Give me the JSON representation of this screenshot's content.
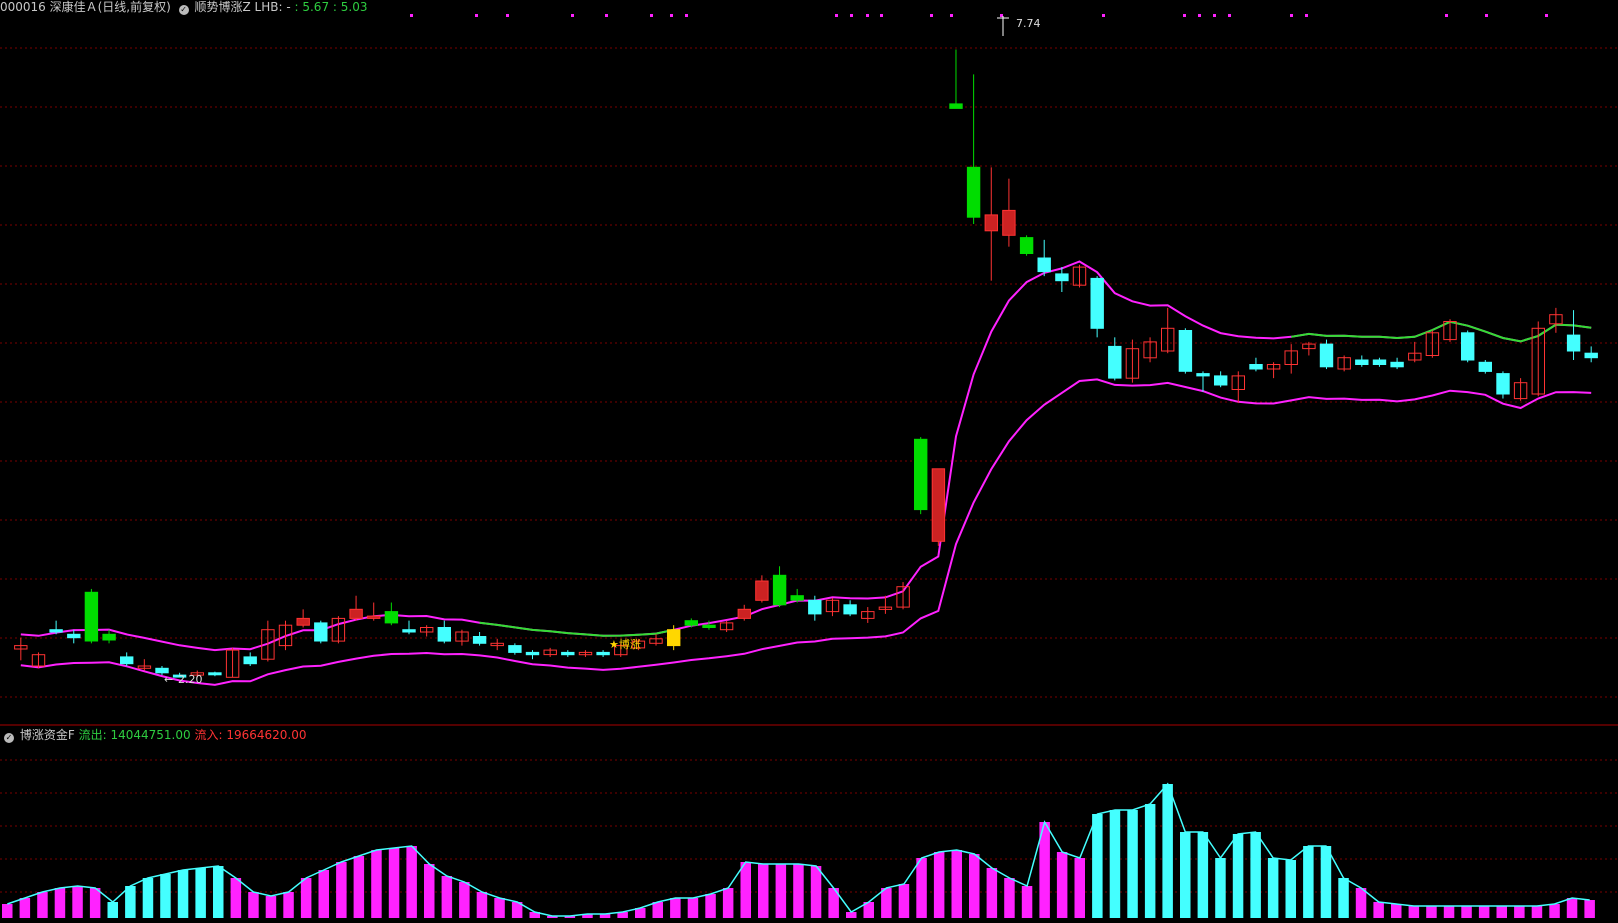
{
  "header": {
    "symbol_title": "000016 深康佳Ａ(日线,前复权)",
    "indicator_name": "顺势博涨Z",
    "lhb_label": "LHB: -",
    "value1": ": 5.67",
    "value2": ": 5.03"
  },
  "sub_panel": {
    "indicator_name": "博涨资金F",
    "outflow_label": "流出:",
    "outflow_value": "14044751.00",
    "inflow_label": "流入:",
    "inflow_value": "19664620.00"
  },
  "annotations": {
    "high_label": "7.74",
    "low_label": "2.20",
    "signal_label": "★博涨"
  },
  "colors": {
    "background": "#000000",
    "grid": "#7a0000",
    "up": "#ff3333",
    "down_solid": "#00dd00",
    "cyan": "#44ffff",
    "magenta": "#ff22ff",
    "green_line": "#33dd33",
    "yellow": "#ffd700"
  },
  "chart_data": {
    "type": "candlestick",
    "y_range": [
      2.0,
      8.0
    ],
    "candles": [
      {
        "o": 2.45,
        "h": 2.55,
        "l": 2.35,
        "c": 2.48,
        "t": "up"
      },
      {
        "o": 2.3,
        "h": 2.42,
        "l": 2.28,
        "c": 2.4,
        "t": "up"
      },
      {
        "o": 2.62,
        "h": 2.7,
        "l": 2.58,
        "c": 2.6,
        "t": "flat"
      },
      {
        "o": 2.55,
        "h": 2.62,
        "l": 2.5,
        "c": 2.58,
        "t": "flat"
      },
      {
        "o": 2.95,
        "h": 2.98,
        "l": 2.5,
        "c": 2.52,
        "t": "down"
      },
      {
        "o": 2.58,
        "h": 2.62,
        "l": 2.5,
        "c": 2.53,
        "t": "down"
      },
      {
        "o": 2.38,
        "h": 2.42,
        "l": 2.3,
        "c": 2.32,
        "t": "cyan"
      },
      {
        "o": 2.3,
        "h": 2.36,
        "l": 2.26,
        "c": 2.28,
        "t": "up"
      },
      {
        "o": 2.28,
        "h": 2.3,
        "l": 2.22,
        "c": 2.24,
        "t": "cyan"
      },
      {
        "o": 2.22,
        "h": 2.24,
        "l": 2.2,
        "c": 2.21,
        "t": "cyan"
      },
      {
        "o": 2.22,
        "h": 2.26,
        "l": 2.2,
        "c": 2.24,
        "t": "up"
      },
      {
        "o": 2.23,
        "h": 2.25,
        "l": 2.21,
        "c": 2.24,
        "t": "flat"
      },
      {
        "o": 2.2,
        "h": 2.46,
        "l": 2.2,
        "c": 2.44,
        "t": "up"
      },
      {
        "o": 2.38,
        "h": 2.42,
        "l": 2.3,
        "c": 2.32,
        "t": "cyan"
      },
      {
        "o": 2.36,
        "h": 2.7,
        "l": 2.34,
        "c": 2.62,
        "t": "up"
      },
      {
        "o": 2.48,
        "h": 2.7,
        "l": 2.44,
        "c": 2.66,
        "t": "up"
      },
      {
        "o": 2.72,
        "h": 2.8,
        "l": 2.64,
        "c": 2.66,
        "t": "upfill"
      },
      {
        "o": 2.68,
        "h": 2.7,
        "l": 2.5,
        "c": 2.52,
        "t": "cyan"
      },
      {
        "o": 2.52,
        "h": 2.74,
        "l": 2.5,
        "c": 2.72,
        "t": "up"
      },
      {
        "o": 2.8,
        "h": 2.92,
        "l": 2.7,
        "c": 2.72,
        "t": "upfill"
      },
      {
        "o": 2.74,
        "h": 2.86,
        "l": 2.7,
        "c": 2.72,
        "t": "upfill"
      },
      {
        "o": 2.78,
        "h": 2.86,
        "l": 2.66,
        "c": 2.68,
        "t": "down"
      },
      {
        "o": 2.62,
        "h": 2.7,
        "l": 2.58,
        "c": 2.6,
        "t": "cyan"
      },
      {
        "o": 2.6,
        "h": 2.66,
        "l": 2.56,
        "c": 2.64,
        "t": "up"
      },
      {
        "o": 2.64,
        "h": 2.7,
        "l": 2.5,
        "c": 2.52,
        "t": "cyan"
      },
      {
        "o": 2.52,
        "h": 2.62,
        "l": 2.48,
        "c": 2.6,
        "t": "up"
      },
      {
        "o": 2.56,
        "h": 2.6,
        "l": 2.48,
        "c": 2.5,
        "t": "cyan"
      },
      {
        "o": 2.5,
        "h": 2.54,
        "l": 2.44,
        "c": 2.48,
        "t": "up"
      },
      {
        "o": 2.48,
        "h": 2.5,
        "l": 2.4,
        "c": 2.42,
        "t": "cyan"
      },
      {
        "o": 2.42,
        "h": 2.44,
        "l": 2.36,
        "c": 2.4,
        "t": "flat"
      },
      {
        "o": 2.4,
        "h": 2.46,
        "l": 2.38,
        "c": 2.44,
        "t": "up"
      },
      {
        "o": 2.42,
        "h": 2.44,
        "l": 2.38,
        "c": 2.4,
        "t": "cyan"
      },
      {
        "o": 2.4,
        "h": 2.44,
        "l": 2.38,
        "c": 2.42,
        "t": "up"
      },
      {
        "o": 2.42,
        "h": 2.44,
        "l": 2.38,
        "c": 2.4,
        "t": "cyan"
      },
      {
        "o": 2.4,
        "h": 2.5,
        "l": 2.38,
        "c": 2.48,
        "t": "up"
      },
      {
        "o": 2.46,
        "h": 2.54,
        "l": 2.44,
        "c": 2.52,
        "t": "up"
      },
      {
        "o": 2.5,
        "h": 2.58,
        "l": 2.48,
        "c": 2.54,
        "t": "up"
      },
      {
        "o": 2.48,
        "h": 2.66,
        "l": 2.44,
        "c": 2.62,
        "t": "yellow"
      },
      {
        "o": 2.7,
        "h": 2.72,
        "l": 2.64,
        "c": 2.66,
        "t": "down"
      },
      {
        "o": 2.66,
        "h": 2.7,
        "l": 2.62,
        "c": 2.64,
        "t": "down"
      },
      {
        "o": 2.62,
        "h": 2.7,
        "l": 2.6,
        "c": 2.68,
        "t": "up"
      },
      {
        "o": 2.8,
        "h": 2.84,
        "l": 2.7,
        "c": 2.72,
        "t": "upfill"
      },
      {
        "o": 3.05,
        "h": 3.1,
        "l": 2.86,
        "c": 2.88,
        "t": "upfill"
      },
      {
        "o": 3.1,
        "h": 3.18,
        "l": 2.82,
        "c": 2.84,
        "t": "down"
      },
      {
        "o": 2.92,
        "h": 2.98,
        "l": 2.86,
        "c": 2.88,
        "t": "down"
      },
      {
        "o": 2.88,
        "h": 2.92,
        "l": 2.7,
        "c": 2.76,
        "t": "cyan"
      },
      {
        "o": 2.78,
        "h": 2.9,
        "l": 2.74,
        "c": 2.88,
        "t": "up"
      },
      {
        "o": 2.84,
        "h": 2.88,
        "l": 2.74,
        "c": 2.76,
        "t": "cyan"
      },
      {
        "o": 2.72,
        "h": 2.82,
        "l": 2.68,
        "c": 2.78,
        "t": "up"
      },
      {
        "o": 2.8,
        "h": 2.92,
        "l": 2.76,
        "c": 2.82,
        "t": "up"
      },
      {
        "o": 2.82,
        "h": 3.04,
        "l": 2.8,
        "c": 3.0,
        "t": "up"
      },
      {
        "o": 4.3,
        "h": 4.32,
        "l": 3.64,
        "c": 3.68,
        "t": "down"
      },
      {
        "o": 4.04,
        "h": 4.04,
        "l": 3.36,
        "c": 3.4,
        "t": "upfill"
      },
      {
        "o": 7.26,
        "h": 7.74,
        "l": 7.24,
        "c": 7.22,
        "t": "down"
      },
      {
        "o": 6.7,
        "h": 7.52,
        "l": 6.2,
        "c": 6.26,
        "t": "down"
      },
      {
        "o": 6.28,
        "h": 6.7,
        "l": 5.7,
        "c": 6.14,
        "t": "upfill"
      },
      {
        "o": 6.32,
        "h": 6.6,
        "l": 6.0,
        "c": 6.1,
        "t": "upfill"
      },
      {
        "o": 6.08,
        "h": 6.1,
        "l": 5.92,
        "c": 5.94,
        "t": "down"
      },
      {
        "o": 5.9,
        "h": 6.06,
        "l": 5.74,
        "c": 5.78,
        "t": "cyan"
      },
      {
        "o": 5.76,
        "h": 5.82,
        "l": 5.6,
        "c": 5.7,
        "t": "cyan"
      },
      {
        "o": 5.66,
        "h": 5.84,
        "l": 5.64,
        "c": 5.82,
        "t": "up"
      },
      {
        "o": 5.72,
        "h": 5.74,
        "l": 5.2,
        "c": 5.28,
        "t": "cyan"
      },
      {
        "o": 5.12,
        "h": 5.2,
        "l": 4.82,
        "c": 4.84,
        "t": "cyan"
      },
      {
        "o": 4.84,
        "h": 5.18,
        "l": 4.8,
        "c": 5.1,
        "t": "up"
      },
      {
        "o": 5.02,
        "h": 5.2,
        "l": 4.98,
        "c": 5.16,
        "t": "up"
      },
      {
        "o": 5.08,
        "h": 5.46,
        "l": 5.06,
        "c": 5.28,
        "t": "up"
      },
      {
        "o": 5.26,
        "h": 5.28,
        "l": 4.88,
        "c": 4.9,
        "t": "cyan"
      },
      {
        "o": 4.88,
        "h": 4.9,
        "l": 4.72,
        "c": 4.86,
        "t": "cyan"
      },
      {
        "o": 4.86,
        "h": 4.9,
        "l": 4.76,
        "c": 4.78,
        "t": "cyan"
      },
      {
        "o": 4.74,
        "h": 4.9,
        "l": 4.62,
        "c": 4.86,
        "t": "up"
      },
      {
        "o": 4.96,
        "h": 5.02,
        "l": 4.9,
        "c": 4.92,
        "t": "cyan"
      },
      {
        "o": 4.92,
        "h": 4.98,
        "l": 4.84,
        "c": 4.96,
        "t": "up"
      },
      {
        "o": 4.96,
        "h": 5.14,
        "l": 4.88,
        "c": 5.08,
        "t": "up"
      },
      {
        "o": 5.1,
        "h": 5.16,
        "l": 5.04,
        "c": 5.14,
        "t": "up"
      },
      {
        "o": 5.14,
        "h": 5.18,
        "l": 4.92,
        "c": 4.94,
        "t": "cyan"
      },
      {
        "o": 4.92,
        "h": 5.04,
        "l": 4.9,
        "c": 5.02,
        "t": "up"
      },
      {
        "o": 5.0,
        "h": 5.04,
        "l": 4.94,
        "c": 4.96,
        "t": "cyan"
      },
      {
        "o": 4.96,
        "h": 5.02,
        "l": 4.94,
        "c": 5.0,
        "t": "flat"
      },
      {
        "o": 4.98,
        "h": 5.02,
        "l": 4.92,
        "c": 4.94,
        "t": "cyan"
      },
      {
        "o": 5.0,
        "h": 5.16,
        "l": 4.98,
        "c": 5.06,
        "t": "up"
      },
      {
        "o": 5.04,
        "h": 5.26,
        "l": 5.02,
        "c": 5.24,
        "t": "up"
      },
      {
        "o": 5.18,
        "h": 5.36,
        "l": 5.16,
        "c": 5.34,
        "t": "up"
      },
      {
        "o": 5.24,
        "h": 5.26,
        "l": 4.98,
        "c": 5.0,
        "t": "cyan"
      },
      {
        "o": 4.98,
        "h": 5.0,
        "l": 4.88,
        "c": 4.9,
        "t": "cyan"
      },
      {
        "o": 4.88,
        "h": 4.9,
        "l": 4.66,
        "c": 4.7,
        "t": "cyan"
      },
      {
        "o": 4.66,
        "h": 4.84,
        "l": 4.64,
        "c": 4.8,
        "t": "up"
      },
      {
        "o": 4.7,
        "h": 5.34,
        "l": 4.68,
        "c": 5.28,
        "t": "up"
      },
      {
        "o": 5.32,
        "h": 5.46,
        "l": 5.24,
        "c": 5.4,
        "t": "up"
      },
      {
        "o": 5.22,
        "h": 5.44,
        "l": 5.0,
        "c": 5.08,
        "t": "cyan"
      },
      {
        "o": 5.06,
        "h": 5.12,
        "l": 4.98,
        "c": 5.02,
        "t": "cyan"
      }
    ],
    "indicator_bars": [
      14,
      20,
      26,
      30,
      32,
      30,
      16,
      32,
      40,
      44,
      48,
      50,
      52,
      40,
      26,
      22,
      26,
      40,
      48,
      56,
      62,
      68,
      70,
      72,
      54,
      42,
      36,
      26,
      20,
      16,
      6,
      2,
      2,
      4,
      4,
      6,
      10,
      16,
      20,
      20,
      24,
      30,
      56,
      54,
      54,
      54,
      52,
      30,
      6,
      16,
      30,
      34,
      60,
      66,
      68,
      64,
      50,
      40,
      32,
      96,
      66,
      60,
      104,
      108,
      108,
      114,
      134,
      86,
      86,
      60,
      84,
      86,
      60,
      58,
      72,
      72,
      40,
      30,
      16,
      14,
      12,
      12,
      12,
      12,
      12,
      12,
      12,
      12,
      14,
      20,
      18
    ]
  }
}
